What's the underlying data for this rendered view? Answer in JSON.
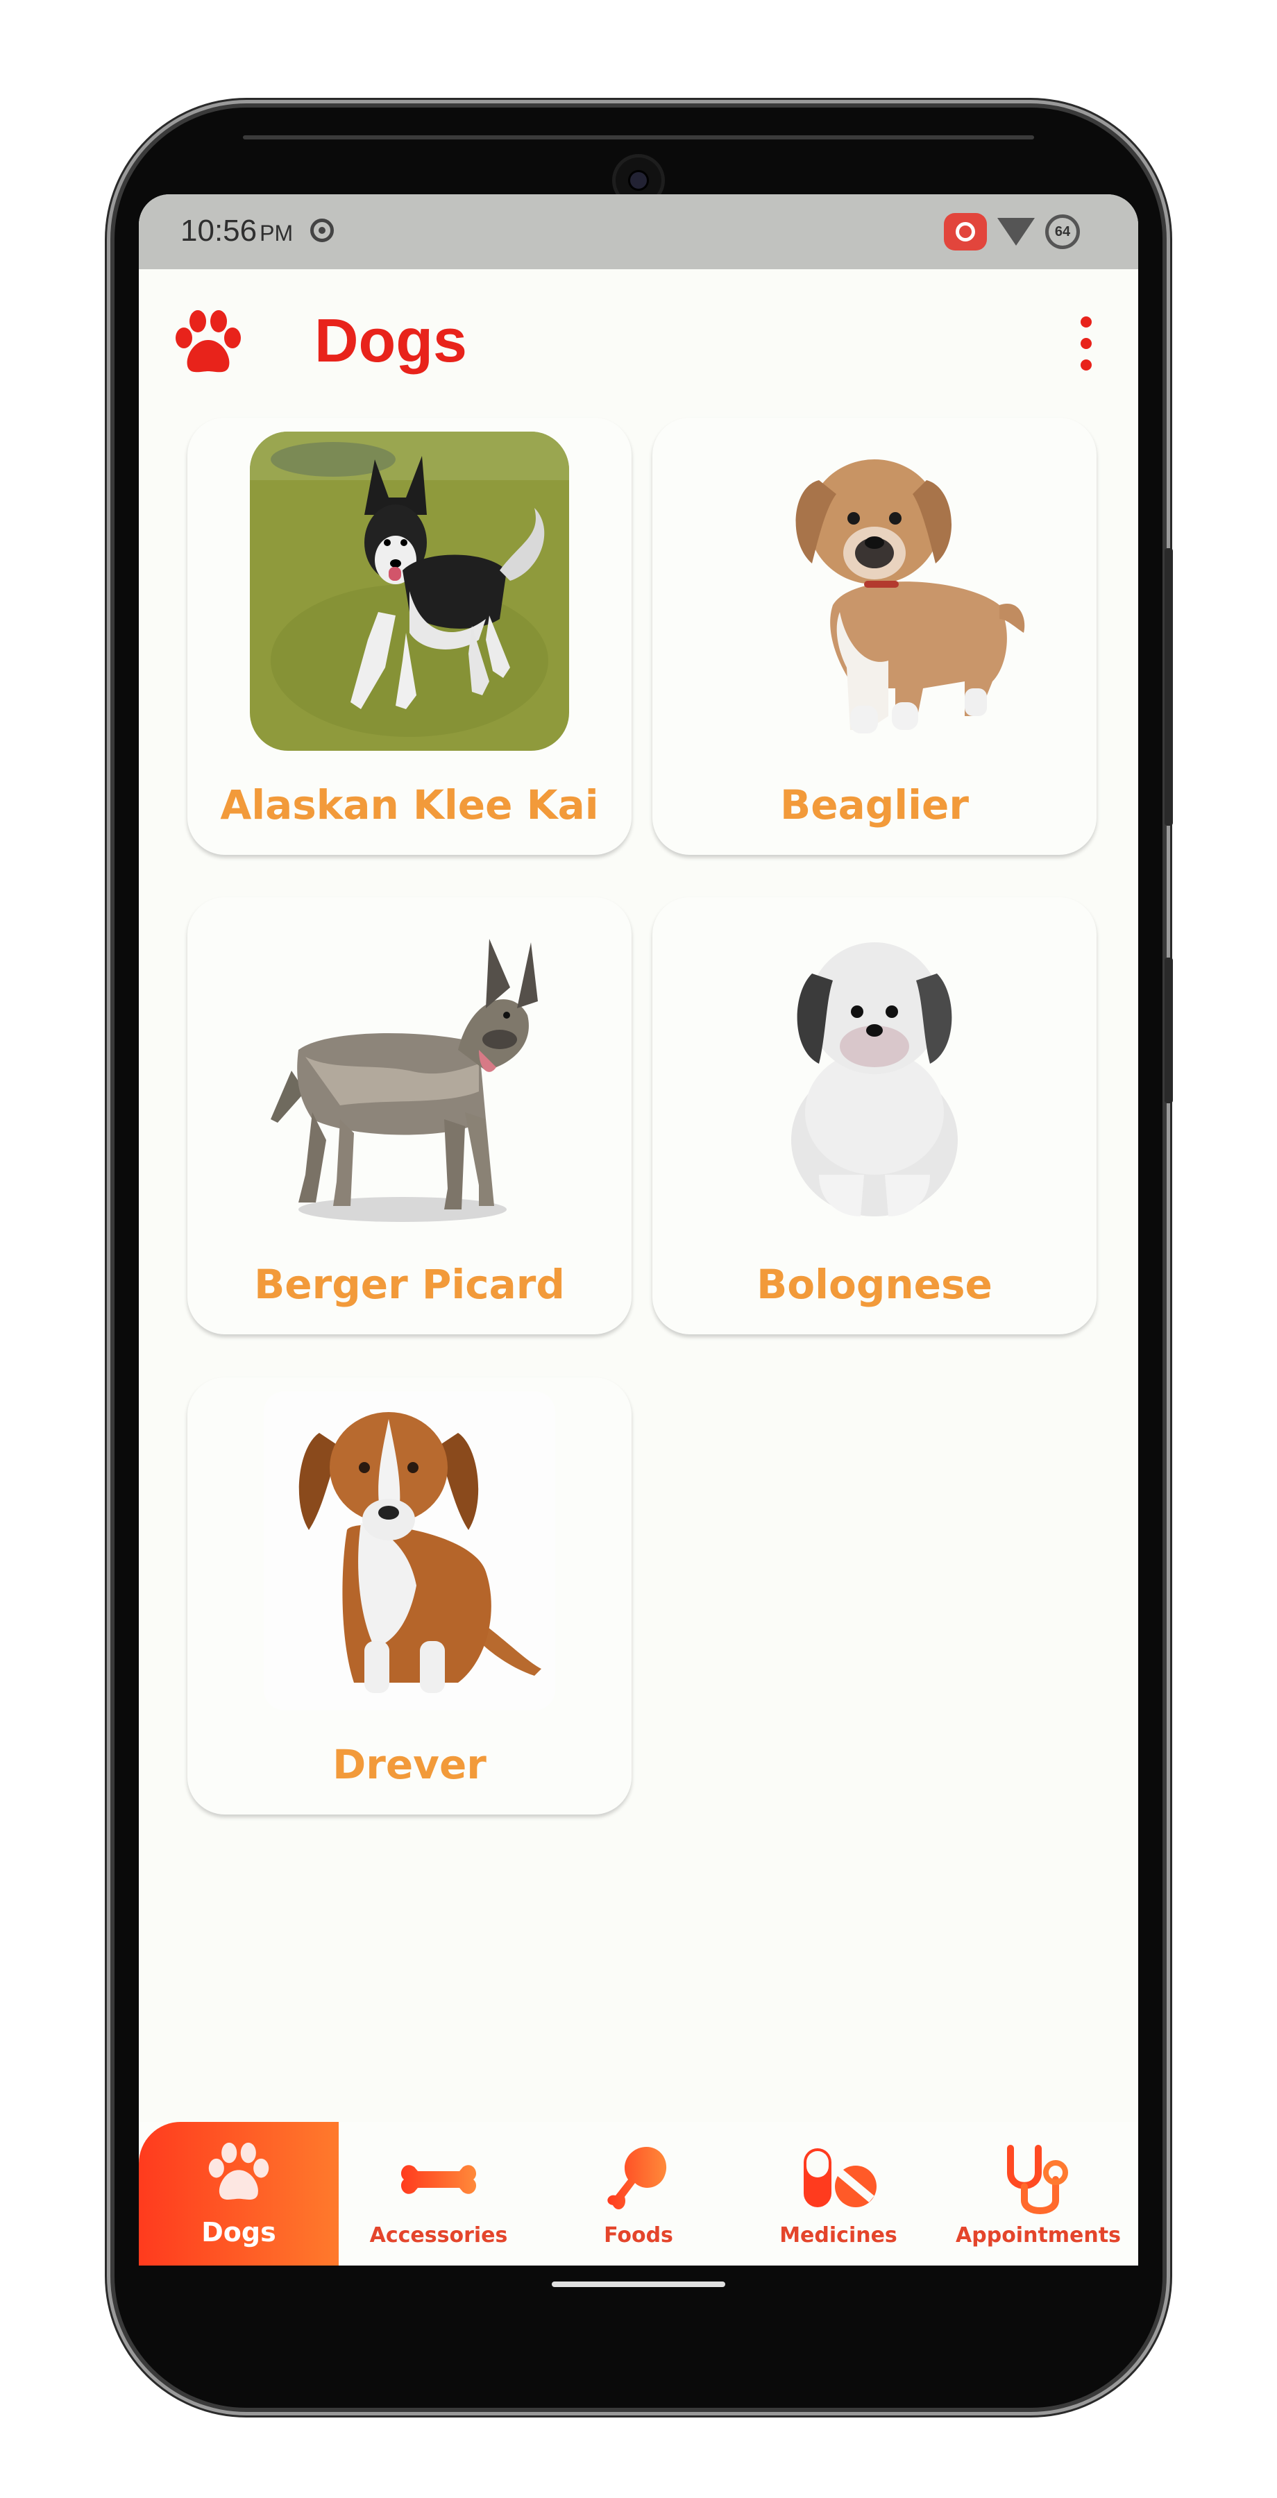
{
  "status_bar": {
    "time": "10:56",
    "ampm": "PM",
    "battery_text": "64"
  },
  "app_bar": {
    "title": "Dogs",
    "logo_icon": "paw-icon",
    "menu_icon": "more-vert-icon"
  },
  "breeds": [
    {
      "name": "Alaskan Klee Kai"
    },
    {
      "name": "Beaglier"
    },
    {
      "name": "Berger Picard"
    },
    {
      "name": "Bolognese"
    },
    {
      "name": "Drever"
    }
  ],
  "bottom_nav": {
    "items": [
      {
        "label": "Dogs",
        "icon": "paw-icon",
        "active": true
      },
      {
        "label": "Accessories",
        "icon": "bone-icon",
        "active": false
      },
      {
        "label": "Foods",
        "icon": "meat-leg-icon",
        "active": false
      },
      {
        "label": "Medicines",
        "icon": "pills-icon",
        "active": false
      },
      {
        "label": "Appointments",
        "icon": "stethoscope-icon",
        "active": false
      }
    ]
  },
  "colors": {
    "accent_red": "#e8231b",
    "breed_name_orange": "#f29a3a",
    "nav_gradient_start": "#ff3b1e",
    "nav_gradient_end": "#ff7a2c"
  }
}
